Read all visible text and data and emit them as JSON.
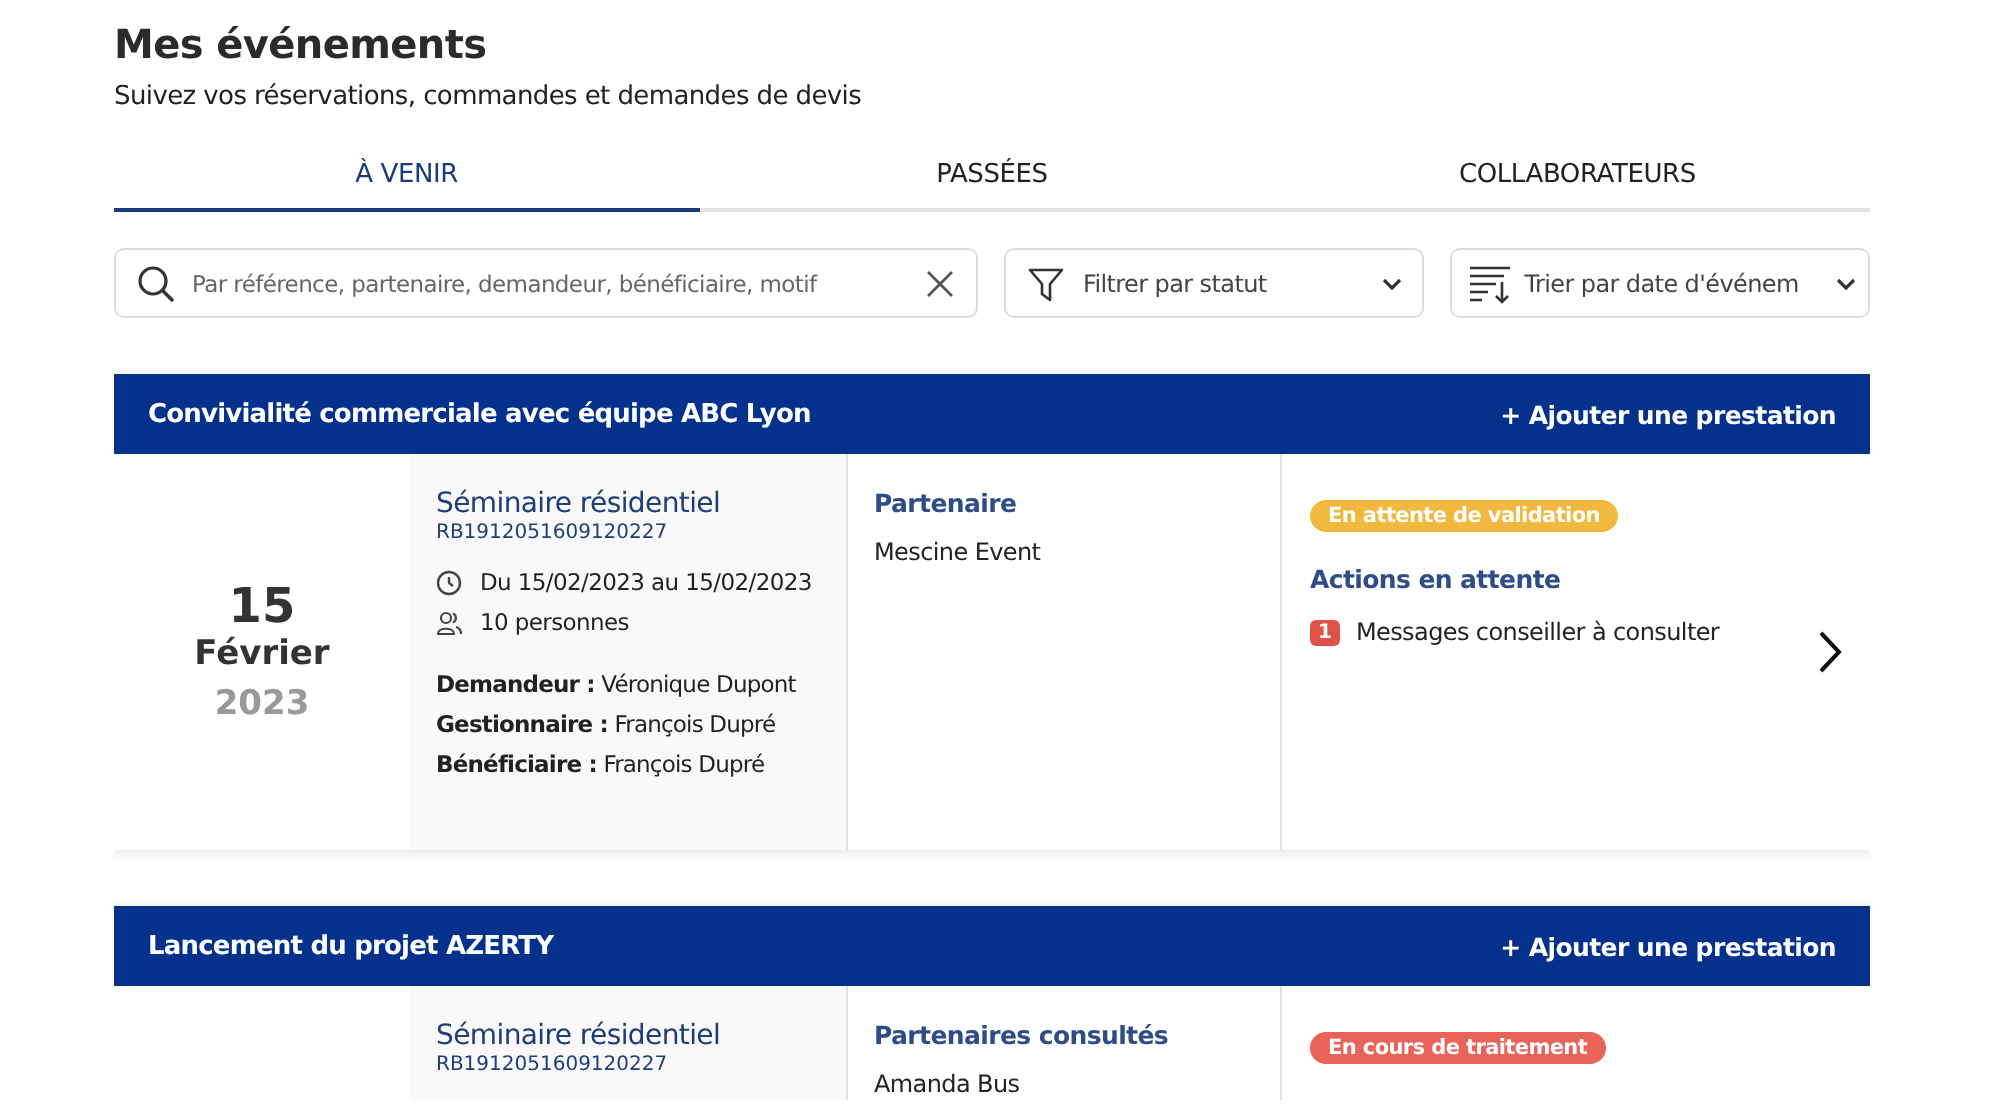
{
  "page": {
    "title": "Mes événements",
    "subtitle": "Suivez vos réservations, commandes et demandes de devis"
  },
  "tabs": [
    {
      "label": "À VENIR",
      "selected": true
    },
    {
      "label": "PASSÉES",
      "selected": false
    },
    {
      "label": "COLLABORATEURS",
      "selected": false
    }
  ],
  "search": {
    "placeholder": "Par référence, partenaire, demandeur, bénéficiaire, motif"
  },
  "status_filter": {
    "placeholder": "Filtrer par statut"
  },
  "sort": {
    "value": "Trier par date d'événem"
  },
  "events": [
    {
      "title": "Convivialité commerciale avec équipe ABC Lyon",
      "add_label": "+ Ajouter une prestation",
      "day": "15",
      "month": "Février",
      "year": "2023",
      "service": "Séminaire résidentiel",
      "reference": "RB1912051609120227",
      "dates": "Du 15/02/2023 au 15/02/2023",
      "people": "10 personnes",
      "contacts": [
        {
          "role": "Demandeur :",
          "name": "Véronique Dupont"
        },
        {
          "role": "Gestionnaire :",
          "name": "François Dupré"
        },
        {
          "role": "Bénéficiaire :",
          "name": "François Dupré"
        }
      ],
      "partner_heading": "Partenaire",
      "partners": [
        "Mescine Event"
      ],
      "status": {
        "label": "En attente de validation",
        "color": "#f0b83e"
      },
      "actions_heading": "Actions en attente",
      "actions": [
        {
          "count": "1",
          "label": "Messages conseiller à consulter"
        }
      ]
    },
    {
      "title": "Lancement du projet AZERTY",
      "add_label": "+ Ajouter une prestation",
      "service": "Séminaire résidentiel",
      "reference": "RB1912051609120227",
      "partner_heading": "Partenaires consultés",
      "partners": [
        "Amanda Bus"
      ],
      "status": {
        "label": "En cours de traitement",
        "color": "#e8645a"
      }
    }
  ]
}
